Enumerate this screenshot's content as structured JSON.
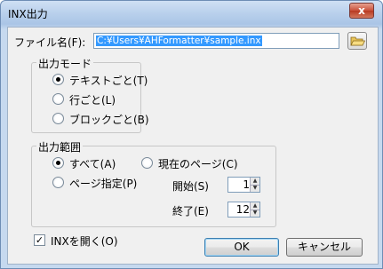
{
  "window": {
    "title": "INX出力",
    "close_glyph": "x"
  },
  "file": {
    "label": "ファイル名(F):",
    "value": "C:¥Users¥AHFormatter¥sample.inx",
    "browse_icon": "folder-open-icon"
  },
  "output_mode": {
    "title": "出力モード",
    "options": [
      "テキストごと(T)",
      "行ごと(L)",
      "ブロックごと(B)"
    ],
    "selected_index": 0
  },
  "output_range": {
    "title": "出力範囲",
    "all_label": "すべて(A)",
    "page_spec_label": "ページ指定(P)",
    "current_page_label": "現在のページ(C)",
    "selected": "all",
    "start_label": "開始(S)",
    "start_value": "1",
    "end_label": "終了(E)",
    "end_value": "12"
  },
  "open_inx": {
    "label": "INXを開く(O)",
    "checked": true
  },
  "buttons": {
    "ok": "OK",
    "cancel": "キャンセル"
  }
}
